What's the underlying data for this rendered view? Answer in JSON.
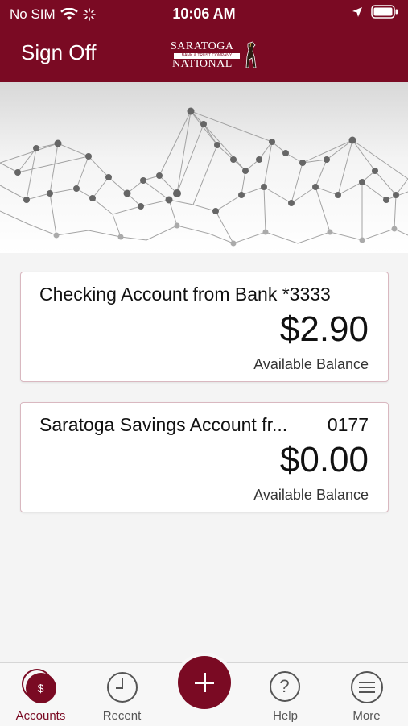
{
  "status_bar": {
    "carrier": "No SIM",
    "time": "10:06 AM"
  },
  "header": {
    "signoff_label": "Sign Off",
    "logo_top": "SARATOGA",
    "logo_band": "BANK & TRUST COMPANY",
    "logo_bottom": "NATIONAL",
    "brand_color": "#7a0a23"
  },
  "accounts": [
    {
      "name": "Checking Account from Bank *3333",
      "number": "",
      "balance": "$2.90",
      "balance_label": "Available Balance"
    },
    {
      "name": "Saratoga Savings Account fr...",
      "number": "0177",
      "balance": "$0.00",
      "balance_label": "Available Balance"
    }
  ],
  "tabs": {
    "accounts": "Accounts",
    "recent": "Recent",
    "help": "Help",
    "more": "More",
    "accounts_glyph": "$",
    "help_glyph": "?"
  }
}
